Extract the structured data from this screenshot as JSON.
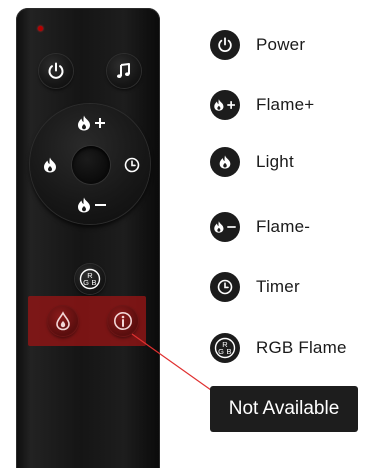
{
  "legend": [
    {
      "label": "Power",
      "icon": "power-icon"
    },
    {
      "label": "Flame+",
      "icon": "flame-plus-icon"
    },
    {
      "label": "Light",
      "icon": "flame-icon"
    },
    {
      "label": "Flame-",
      "icon": "flame-minus-icon"
    },
    {
      "label": "Timer",
      "icon": "clock-icon"
    },
    {
      "label": "RGB Flame",
      "icon": "rgb-icon"
    }
  ],
  "remote": {
    "buttons": {
      "power": "power-icon",
      "music": "music-note-icon",
      "dpad_top": "flame-plus-icon",
      "dpad_left": "flame-icon",
      "dpad_right": "clock-icon",
      "dpad_bottom": "flame-minus-icon",
      "rgb": "rgb-icon",
      "drop": "drop-flame-icon",
      "info": "info-icon"
    },
    "rgb_letters": {
      "top": "R",
      "left": "G",
      "right": "B"
    }
  },
  "not_available": {
    "label": "Not Available"
  },
  "colors": {
    "remote_body": "#151515",
    "highlight_zone": "#961414",
    "leader_line": "#e03030",
    "label_bg": "#1d1d1d",
    "icon_white": "#ffffff"
  }
}
